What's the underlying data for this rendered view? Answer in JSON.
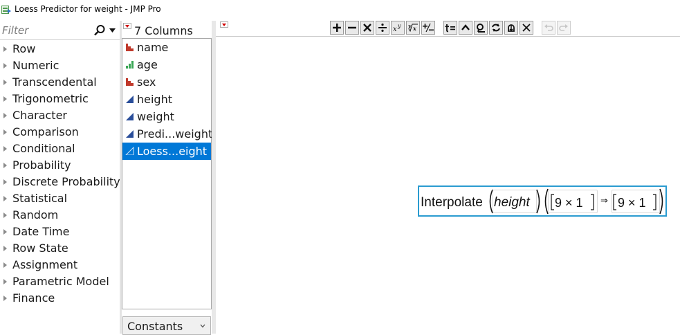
{
  "window": {
    "title": "Loess Predictor for weight - JMP Pro"
  },
  "function_browser": {
    "filter_placeholder": "Filter",
    "items": [
      {
        "label": "Row"
      },
      {
        "label": "Numeric"
      },
      {
        "label": "Transcendental"
      },
      {
        "label": "Trigonometric"
      },
      {
        "label": "Character"
      },
      {
        "label": "Comparison"
      },
      {
        "label": "Conditional"
      },
      {
        "label": "Probability"
      },
      {
        "label": "Discrete Probability"
      },
      {
        "label": "Statistical"
      },
      {
        "label": "Random"
      },
      {
        "label": "Date Time"
      },
      {
        "label": "Row State"
      },
      {
        "label": "Assignment"
      },
      {
        "label": "Parametric Model"
      },
      {
        "label": "Finance"
      }
    ]
  },
  "columns": {
    "header": "7 Columns",
    "items": [
      {
        "label": "name",
        "icon": "nominal-icon",
        "selected": false
      },
      {
        "label": "age",
        "icon": "ordinal-icon",
        "selected": false
      },
      {
        "label": "sex",
        "icon": "nominal-icon",
        "selected": false
      },
      {
        "label": "height",
        "icon": "continuous-icon",
        "selected": false
      },
      {
        "label": "weight",
        "icon": "continuous-icon",
        "selected": false
      },
      {
        "label": "Predi...weight",
        "icon": "continuous-icon",
        "selected": false
      },
      {
        "label": "Loess...eight",
        "icon": "continuous-formula-icon",
        "selected": true
      }
    ],
    "constants_label": "Constants"
  },
  "toolbar": {
    "buttons": [
      {
        "name": "add-icon",
        "glyph": "+"
      },
      {
        "name": "subtract-icon",
        "glyph": "−"
      },
      {
        "name": "multiply-icon",
        "glyph": "×"
      },
      {
        "name": "divide-icon",
        "glyph": "÷"
      },
      {
        "name": "power-icon",
        "glyph": "xʸ"
      },
      {
        "name": "root-icon",
        "glyph": "ʸ√x"
      },
      {
        "name": "plus-minus-icon",
        "glyph": "+⁄−"
      },
      {
        "name": "assignment-icon",
        "glyph": "t="
      },
      {
        "name": "caret-up-icon",
        "glyph": "^"
      },
      {
        "name": "peel-icon",
        "glyph": "ϙ"
      },
      {
        "name": "swap-icon",
        "glyph": "⟳"
      },
      {
        "name": "unlock-icon",
        "glyph": "⚲"
      },
      {
        "name": "delete-icon",
        "glyph": "✕"
      },
      {
        "name": "undo-icon",
        "glyph": "↶"
      },
      {
        "name": "redo-icon",
        "glyph": "↷"
      }
    ]
  },
  "formula": {
    "function_name": "Interpolate",
    "argument": "height",
    "matrix_x": "9 × 1",
    "matrix_y": "9 × 1",
    "arrow": "⇒"
  },
  "colors": {
    "selection": "#0078d7",
    "formula_border": "#2a9bd0",
    "nominal": "#c0392b",
    "ordinal": "#3aa655",
    "continuous": "#2a4e9a"
  }
}
